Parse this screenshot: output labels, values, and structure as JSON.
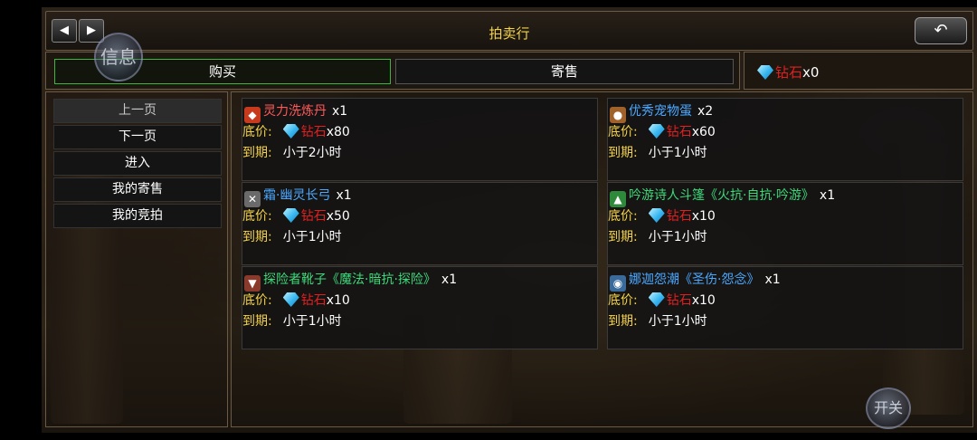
{
  "header": {
    "title": "拍卖行",
    "prev_arrow": "◀",
    "next_arrow": "▶",
    "back_symbol": "↶"
  },
  "tabs": {
    "buy": "购买",
    "sell": "寄售"
  },
  "balance": {
    "currency": "钻石",
    "amount": "x0"
  },
  "overlay": {
    "info_label": "信息",
    "toggle_label": "开关"
  },
  "sidebar": {
    "items": [
      {
        "label": "上一页",
        "disabled": true
      },
      {
        "label": "下一页"
      },
      {
        "label": "进入"
      },
      {
        "label": "我的寄售"
      },
      {
        "label": "我的竞拍"
      }
    ]
  },
  "listing": {
    "price_label": "底价:",
    "expiry_label": "到期:",
    "currency": "钻石",
    "items": [
      {
        "name": "灵力洗炼丹",
        "qty": "x1",
        "price": "x80",
        "expiry": "小于2小时",
        "name_color": "#ff5a5a",
        "icon": "red-gem-icon",
        "icon_color": "#c83a1e"
      },
      {
        "name": "优秀宠物蛋",
        "qty": "x2",
        "price": "x60",
        "expiry": "小于1小时",
        "name_color": "#4aa8ff",
        "icon": "pet-egg-icon",
        "icon_color": "#a0612a"
      },
      {
        "name": "霜·幽灵长弓",
        "qty": "x1",
        "price": "x50",
        "expiry": "小于1小时",
        "name_color": "#4aa8ff",
        "icon": "bow-icon",
        "icon_color": "#6a6a6a"
      },
      {
        "name": "吟游诗人斗篷《火抗·自抗·吟游》",
        "qty": "x1",
        "price": "x10",
        "expiry": "小于1小时",
        "name_color": "#3cd87a",
        "icon": "cloak-icon",
        "icon_color": "#2e8a3a"
      },
      {
        "name": "探险者靴子《魔法·暗抗·探险》",
        "qty": "x1",
        "price": "x10",
        "expiry": "小于1小时",
        "name_color": "#3cd87a",
        "icon": "boots-icon",
        "icon_color": "#8a3a2a"
      },
      {
        "name": "娜迦怨潮《圣伤·怨念》",
        "qty": "x1",
        "price": "x10",
        "expiry": "小于1小时",
        "name_color": "#4aa8ff",
        "icon": "naga-icon",
        "icon_color": "#3a6a9a"
      }
    ]
  }
}
